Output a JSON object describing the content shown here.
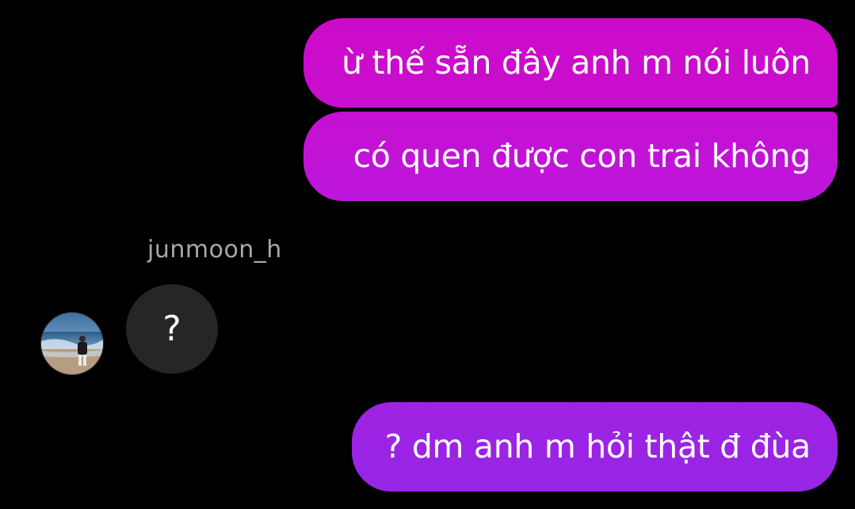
{
  "colors": {
    "background": "#000000",
    "outgoing_top": "#cc0bcb",
    "outgoing_mid": "#c313d8",
    "outgoing_bottom": "#9b25e3",
    "incoming_bubble": "#262626",
    "sender_name": "#a8a8a8"
  },
  "messages": {
    "outgoing": [
      {
        "text": "ừ thế sẵn đây anh m nói luôn"
      },
      {
        "text": "có quen được con trai không"
      },
      {
        "text": "? dm anh m hỏi thật đ đùa"
      }
    ],
    "incoming": {
      "sender": "junmoon_h",
      "text": "?",
      "avatar_icon": "profile-photo-beach"
    }
  }
}
